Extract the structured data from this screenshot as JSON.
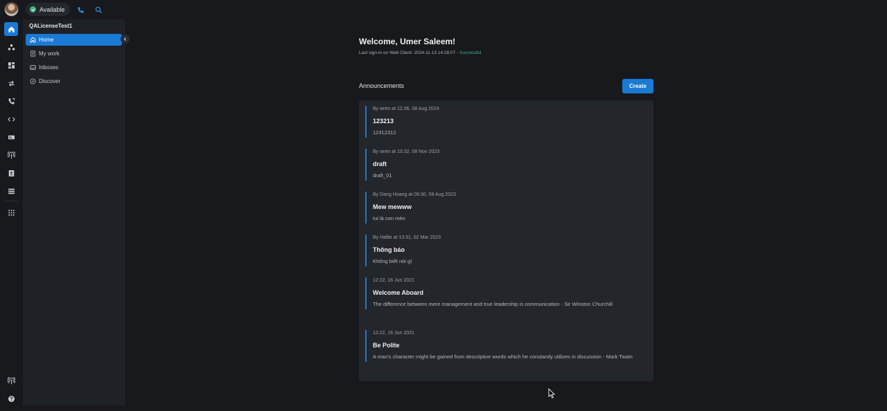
{
  "topbar": {
    "status_label": "Available",
    "status_color": "#43b581"
  },
  "rail": {
    "items": [
      "home-icon",
      "contacts-icon",
      "dashboard-icon",
      "transfer-icon",
      "call-history-icon",
      "code-icon",
      "sms-icon",
      "broadcast-icon",
      "phonebook-icon",
      "queue-icon",
      "apps-grid-icon"
    ],
    "bottom_items": [
      "podcast-icon",
      "help-icon"
    ]
  },
  "nav": {
    "workspace": "QALicenseTest1",
    "items": [
      {
        "label": "Home",
        "icon": "home-icon",
        "active": true
      },
      {
        "label": "My work",
        "icon": "document-icon",
        "active": false
      },
      {
        "label": "Inboxes",
        "icon": "inbox-icon",
        "active": false
      },
      {
        "label": "Discover",
        "icon": "compass-icon",
        "active": false
      }
    ]
  },
  "main": {
    "welcome": "Welcome, Umer Saleem!",
    "last_sign_prefix": "Last sign-in on Web Client: 2024-11-13 14:28:07 - ",
    "last_sign_status": "Successful",
    "announcements_heading": "Announcements",
    "create_label": "Create"
  },
  "announcements": [
    {
      "meta": "By wren at 12:36, 08 Aug 2024",
      "title": "123213",
      "body": "12312312"
    },
    {
      "meta": "By wren at 15:32, 08 Nov 2023",
      "title": "draft",
      "body": "draft_01"
    },
    {
      "meta": "By Dang Hoang at 09:30, 08 Aug 2023",
      "title": "Mew mewww",
      "body": "tui là con mèo"
    },
    {
      "meta": "By Hallie at 13:31, 02 Mar 2023",
      "title": "Thông báo",
      "body": "Không biết nói gì"
    },
    {
      "meta": "12:22, 16 Jun 2021",
      "title": "Welcome Aboard",
      "body": "The difference between mere management and true leadership is communication - Sir Winston Churchill"
    },
    {
      "meta": "12:22, 16 Jun 2021",
      "title": "Be Polite",
      "body": "A man's character might be gained from descriptive words which he constantly utilizes in discussion - Mark Twain"
    }
  ],
  "colors": {
    "accent": "#1a7ad4",
    "background": "#17191d",
    "panel": "#23262b",
    "success": "#43b581"
  }
}
